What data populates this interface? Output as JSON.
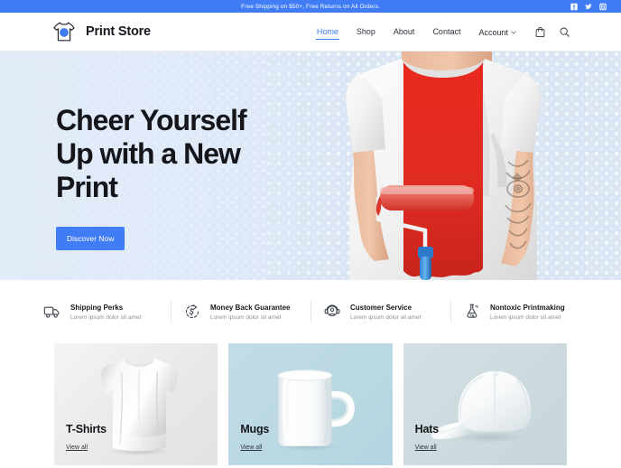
{
  "announcement": {
    "text": "Free Shipping on $50+, Free Returns on All Orders.",
    "background": "#3f7cf5",
    "socials": [
      {
        "name": "facebook-icon",
        "label": "Facebook"
      },
      {
        "name": "twitter-icon",
        "label": "Twitter"
      },
      {
        "name": "instagram-icon",
        "label": "Instagram"
      }
    ]
  },
  "header": {
    "brand_name": "Print Store",
    "logo_icon": "tshirt-logo-icon",
    "nav": [
      {
        "label": "Home",
        "active": true
      },
      {
        "label": "Shop",
        "active": false
      },
      {
        "label": "About",
        "active": false
      },
      {
        "label": "Contact",
        "active": false
      },
      {
        "label": "Account",
        "active": false,
        "caret": "ˇ"
      }
    ],
    "icons": [
      {
        "name": "shopping-bag-icon",
        "label": "Cart"
      },
      {
        "name": "search-icon",
        "label": "Search"
      }
    ]
  },
  "hero": {
    "title_line1": "Cheer Yourself",
    "title_line2": "Up with a New",
    "title_line3": "Print",
    "cta_label": "Discover Now",
    "accent": "#3f7cf5",
    "background": "#dde7f6",
    "image_alt": "Man wearing a white t-shirt with a red paint stripe applied by a paint roller"
  },
  "features": [
    {
      "icon": "delivery-truck-icon",
      "title": "Shipping Perks",
      "subtitle": "Lorem ipsum dolor sit amet"
    },
    {
      "icon": "money-back-icon",
      "title": "Money Back Guarantee",
      "subtitle": "Lorem ipsum dolor sit amet"
    },
    {
      "icon": "headset-support-icon",
      "title": "Customer Service",
      "subtitle": "Lorem ipsum dolor sit amet"
    },
    {
      "icon": "flask-icon",
      "title": "Nontoxic Printmaking",
      "subtitle": "Lorem ipsum dolor sit amet"
    }
  ],
  "categories": [
    {
      "title": "T-Shirts",
      "link_label": "View all",
      "background": "#ececec",
      "image_alt": "White t-shirt"
    },
    {
      "title": "Mugs",
      "link_label": "View all",
      "background": "#bcd9e3",
      "image_alt": "White ceramic mug"
    },
    {
      "title": "Hats",
      "link_label": "View all",
      "background": "#ccdade",
      "image_alt": "White baseball cap"
    }
  ]
}
